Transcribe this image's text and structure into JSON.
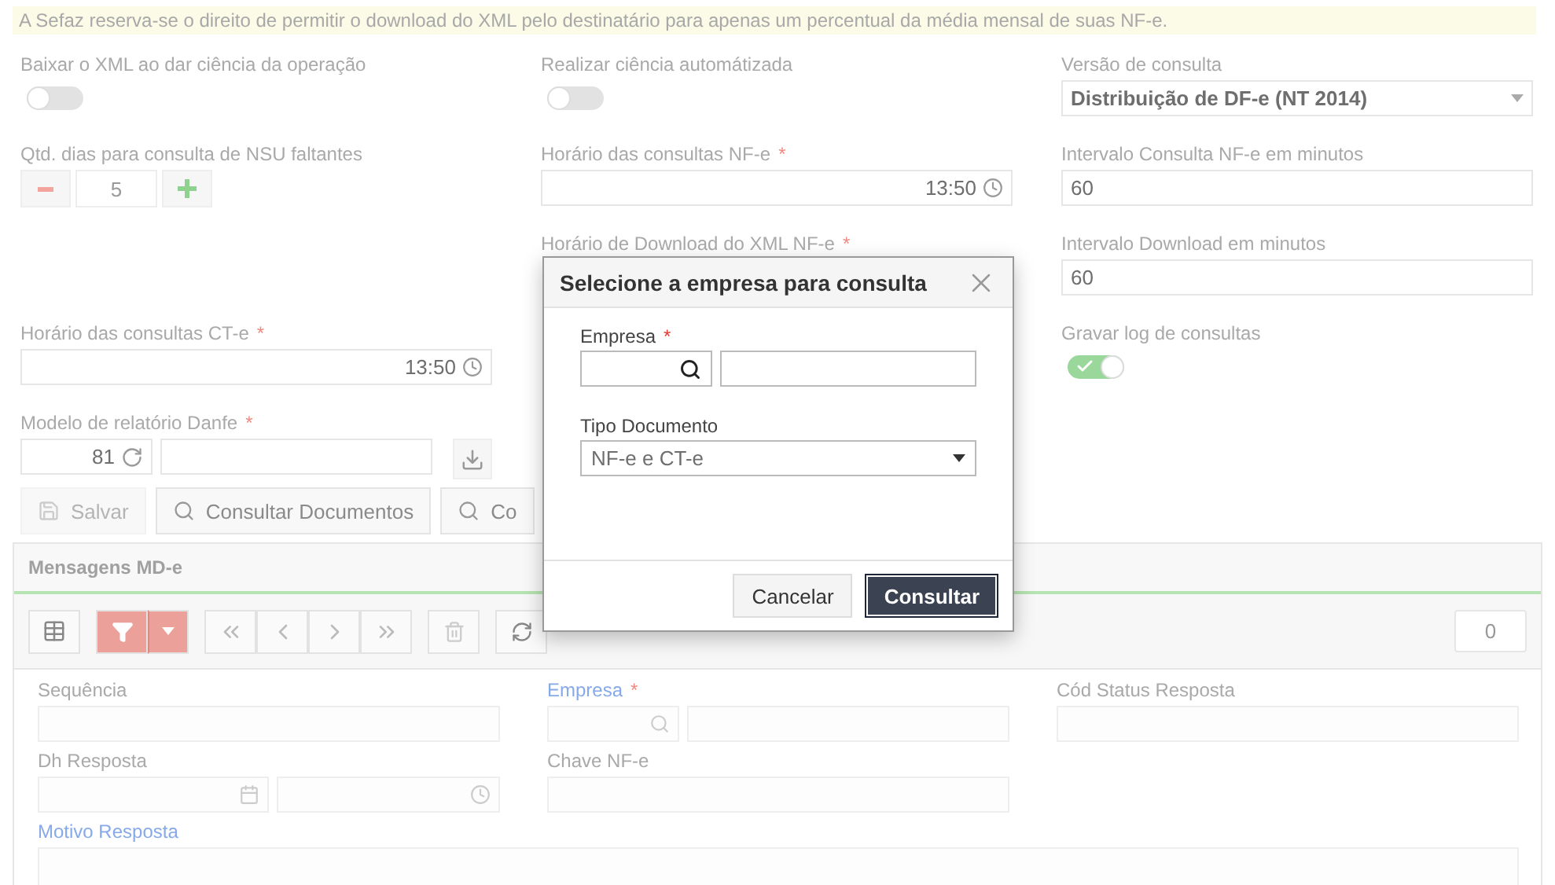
{
  "notice": "A Sefaz reserva-se o direito de permitir o download do XML pelo destinatário para apenas um percentual da média mensal de suas NF-e.",
  "settings": [
    {
      "left": {
        "kind": "toggle",
        "label": "Baixar o XML ao dar ciência da operação",
        "on": false
      },
      "middle": {
        "kind": "toggle",
        "label": "Realizar ciência automátizada",
        "on": false
      },
      "right": {
        "kind": "select",
        "label": "Versão de consulta",
        "value": "Distribuição de DF-e (NT 2014)"
      }
    },
    {
      "left": {
        "kind": "stepper",
        "label": "Qtd. dias para consulta de NSU faltantes",
        "value": "5"
      },
      "middle": {
        "kind": "time",
        "label": "Horário das consultas NF-e",
        "required_mark": "*",
        "value": "13:50"
      },
      "right": {
        "kind": "text",
        "label": "Intervalo Consulta NF-e em minutos",
        "value": "60"
      }
    },
    {
      "middle": {
        "kind": "label",
        "label": "Horário de Download do XML NF-e",
        "required_mark": "*"
      },
      "right": {
        "kind": "text",
        "label": "Intervalo Download em minutos",
        "value": "60"
      }
    },
    {
      "left": {
        "kind": "time",
        "label": "Horário das consultas CT-e",
        "required_mark": "*",
        "value": "13:50"
      },
      "right": {
        "kind": "toggle",
        "label": "Gravar log de consultas",
        "on": true
      }
    },
    {
      "left": {
        "kind": "report",
        "label": "Modelo de relatório Danfe",
        "required_mark": "*",
        "value": "81"
      }
    }
  ],
  "actions": [
    {
      "kind": "save",
      "label": "Salvar",
      "disabled": true
    },
    {
      "kind": "search",
      "label": "Consultar Documentos",
      "disabled": false
    },
    {
      "kind": "search",
      "label": "Co",
      "disabled": false
    }
  ],
  "panel": {
    "title": "Mensagens MD-e",
    "count": "0",
    "rows": [
      {
        "left": {
          "kind": "text",
          "label": "Sequência",
          "highlight": false
        },
        "middle": {
          "kind": "lookup",
          "label": "Empresa",
          "required_mark": "*",
          "highlight": true
        },
        "right": {
          "kind": "text",
          "label": "Cód Status Resposta",
          "highlight": false
        }
      },
      {
        "left": {
          "kind": "datetime",
          "label": "Dh Resposta",
          "highlight": false
        },
        "middle": {
          "kind": "text",
          "label": "Chave NF-e",
          "highlight": false
        }
      },
      {
        "wide": {
          "kind": "textarea",
          "label": "Motivo Resposta",
          "highlight": true
        }
      }
    ]
  },
  "modal": {
    "title": "Selecione a empresa para consulta",
    "fields": [
      {
        "kind": "lookup",
        "label": "Empresa",
        "required_mark": "*"
      },
      {
        "kind": "select",
        "label": "Tipo Documento",
        "value": "NF-e e CT-e"
      }
    ],
    "buttons": [
      {
        "label": "Cancelar",
        "primary": false
      },
      {
        "label": "Consultar",
        "primary": true
      }
    ]
  }
}
